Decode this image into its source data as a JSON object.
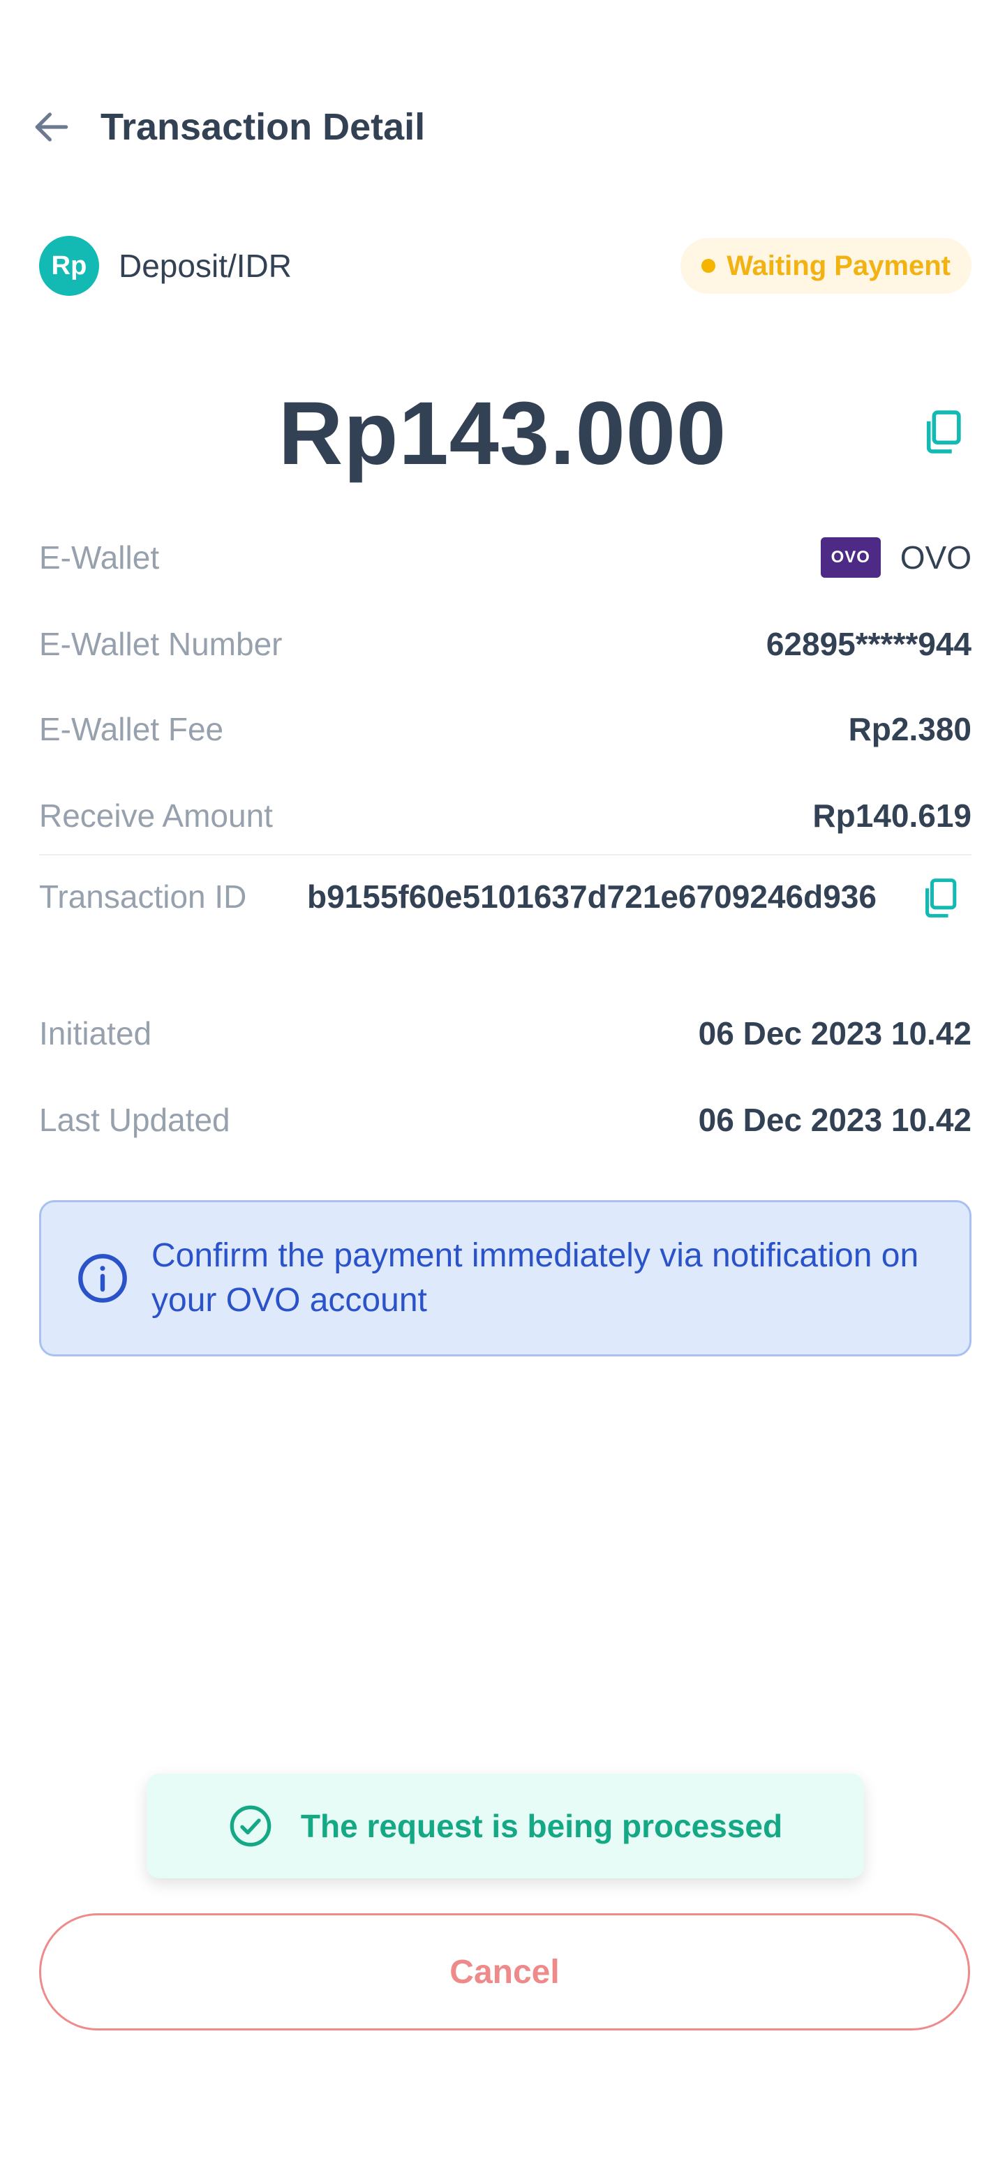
{
  "header": {
    "title": "Transaction Detail",
    "back_icon": "arrow-left-icon"
  },
  "asset": {
    "icon_text": "Rp",
    "label": "Deposit/IDR"
  },
  "status": {
    "text": "Waiting Payment",
    "color": "#f2b212"
  },
  "amount": "Rp143.000",
  "details": {
    "ewallet": {
      "label": "E-Wallet",
      "logo_text": "OVO",
      "value": "OVO"
    },
    "ewallet_number": {
      "label": "E-Wallet Number",
      "value": "62895*****944"
    },
    "ewallet_fee": {
      "label": "E-Wallet Fee",
      "value": "Rp2.380"
    },
    "receive_amount": {
      "label": "Receive Amount",
      "value": "Rp140.619"
    },
    "transaction_id": {
      "label": "Transaction ID",
      "value": "b9155f60e5101637d721e6709246d936"
    },
    "initiated": {
      "label": "Initiated",
      "value": "06 Dec 2023 10.42"
    },
    "last_updated": {
      "label": "Last Updated",
      "value": "06 Dec 2023 10.42"
    }
  },
  "info": {
    "text": "Confirm the payment immediately via notification on your OVO account"
  },
  "toast": {
    "text": "The request is being processed"
  },
  "cancel_button": {
    "label": "Cancel"
  },
  "colors": {
    "accent": "#13b9b3",
    "info_text": "#2a52c9",
    "cancel": "#ee8a8a",
    "success": "#14a884"
  }
}
